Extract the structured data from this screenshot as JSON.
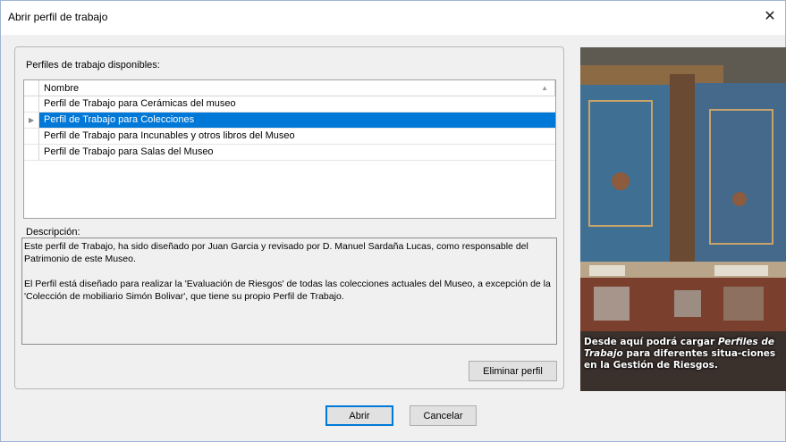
{
  "window": {
    "title": "Abrir perfil de trabajo",
    "close_glyph": "✕"
  },
  "profiles": {
    "label": "Perfiles de trabajo disponibles:",
    "column_header": "Nombre",
    "rows": [
      {
        "name": "Perfil de Trabajo para Cerámicas del museo",
        "selected": false
      },
      {
        "name": "Perfil de Trabajo para Colecciones",
        "selected": true
      },
      {
        "name": "Perfil de Trabajo para Incunables y otros libros del Museo",
        "selected": false
      },
      {
        "name": "Perfil de Trabajo para Salas del Museo",
        "selected": false
      }
    ]
  },
  "description": {
    "label": "Descripción:",
    "paragraph1": "Este perfil de Trabajo, ha sido diseñado por Juan Garcia y revisado por D. Manuel Sardaña Lucas, como responsable del Patrimonio de este Museo.",
    "paragraph2": "El Perfil está diseñado para realizar la 'Evaluación de Riesgos' de todas las colecciones actuales del Museo, a excepción de la 'Colección de mobiliario Simón Bolivar', que tiene su propio Perfil de Trabajo."
  },
  "buttons": {
    "delete": "Eliminar perfil",
    "open": "Abrir",
    "cancel": "Cancelar"
  },
  "side_image": {
    "caption_part1": "Desde aquí podrá cargar ",
    "caption_italic": "Perfiles de Trabajo",
    "caption_part2": " para diferentes situa-ciones en la Gestión de Riesgos."
  },
  "colors": {
    "selection": "#0078d7",
    "window_bg": "#f0f0f0"
  }
}
